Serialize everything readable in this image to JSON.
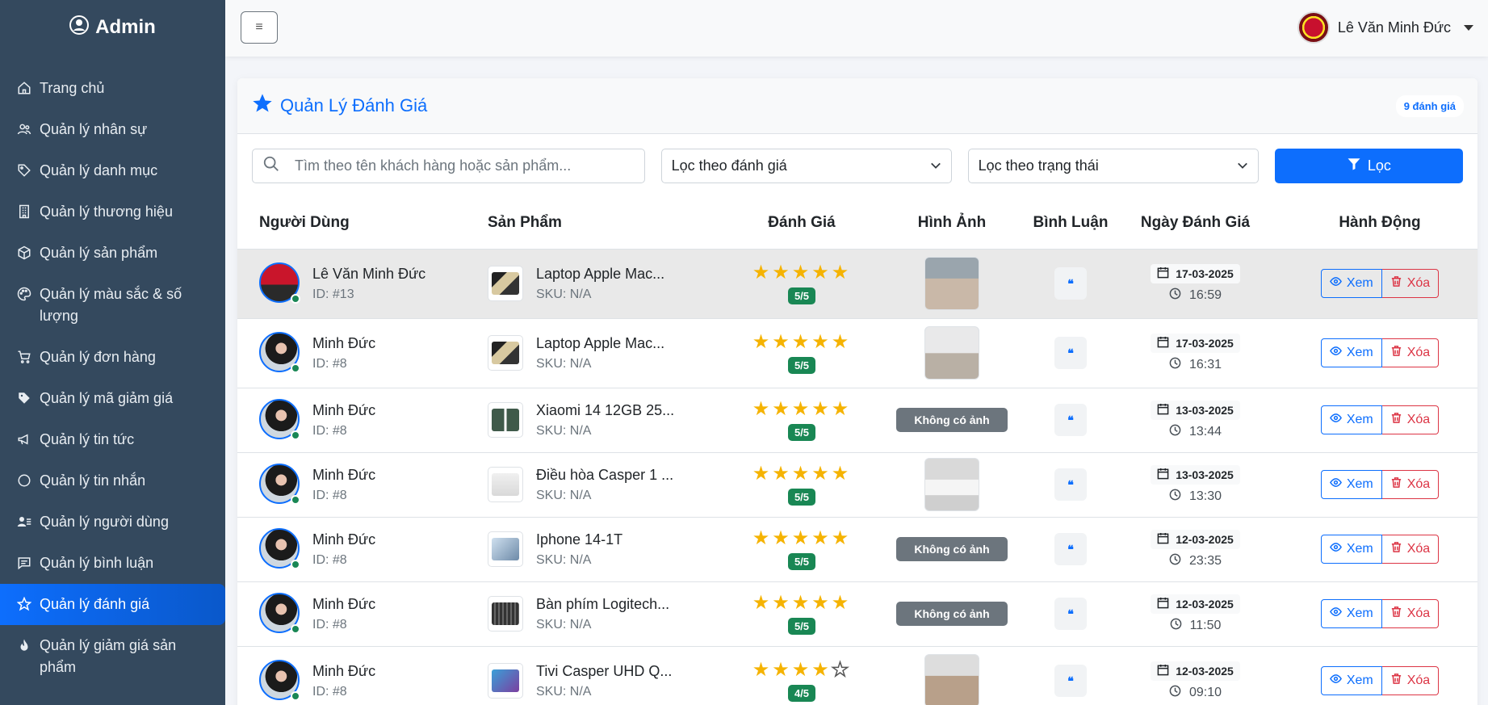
{
  "app": {
    "brand": "Admin"
  },
  "sidebar": {
    "items": [
      {
        "label": "Trang chủ",
        "icon": "home-icon"
      },
      {
        "label": "Quản lý nhân sự",
        "icon": "users-icon"
      },
      {
        "label": "Quản lý danh mục",
        "icon": "tag-icon"
      },
      {
        "label": "Quản lý thương hiệu",
        "icon": "building-icon"
      },
      {
        "label": "Quản lý sản phẩm",
        "icon": "box-icon"
      },
      {
        "label": "Quản lý màu sắc & số lượng",
        "icon": "palette-icon"
      },
      {
        "label": "Quản lý đơn hàng",
        "icon": "cart-icon"
      },
      {
        "label": "Quản lý mã giảm giá",
        "icon": "tag-filled-icon"
      },
      {
        "label": "Quản lý tin tức",
        "icon": "megaphone-icon"
      },
      {
        "label": "Quản lý tin nhắn",
        "icon": "chat-icon"
      },
      {
        "label": "Quản lý người dùng",
        "icon": "user-list-icon"
      },
      {
        "label": "Quản lý bình luận",
        "icon": "comment-icon"
      },
      {
        "label": "Quản lý đánh giá",
        "icon": "star-icon"
      },
      {
        "label": "Quản lý giảm giá sản phẩm",
        "icon": "fire-icon"
      }
    ]
  },
  "topbar": {
    "user_name": "Lê Văn Minh Đức"
  },
  "page": {
    "title": "Quản Lý Đánh Giá",
    "count_badge": "9 đánh giá"
  },
  "filters": {
    "search_placeholder": "Tìm theo tên khách hàng hoặc sản phẩm...",
    "rating_select": "Lọc theo đánh giá",
    "status_select": "Lọc theo trạng thái",
    "filter_button": "Lọc"
  },
  "table": {
    "headers": [
      "Người Dùng",
      "Sản Phẩm",
      "Đánh Giá",
      "Hình Ảnh",
      "Bình Luận",
      "Ngày Đánh Giá",
      "Hành Động"
    ],
    "view_label": "Xem",
    "delete_label": "Xóa",
    "no_image_label": "Không có ảnh",
    "rows": [
      {
        "user": "Lê Văn Minh Đức",
        "user_id": "ID: #13",
        "product": "Laptop Apple Mac...",
        "sku": "SKU: N/A",
        "rating": 5,
        "score": "5/5",
        "has_image": true,
        "date": "17-03-2025",
        "time": "16:59"
      },
      {
        "user": "Minh Đức",
        "user_id": "ID: #8",
        "product": "Laptop Apple Mac...",
        "sku": "SKU: N/A",
        "rating": 5,
        "score": "5/5",
        "has_image": true,
        "date": "17-03-2025",
        "time": "16:31"
      },
      {
        "user": "Minh Đức",
        "user_id": "ID: #8",
        "product": "Xiaomi 14 12GB 25...",
        "sku": "SKU: N/A",
        "rating": 5,
        "score": "5/5",
        "has_image": false,
        "date": "13-03-2025",
        "time": "13:44"
      },
      {
        "user": "Minh Đức",
        "user_id": "ID: #8",
        "product": "Điều hòa Casper 1 ...",
        "sku": "SKU: N/A",
        "rating": 5,
        "score": "5/5",
        "has_image": true,
        "date": "13-03-2025",
        "time": "13:30"
      },
      {
        "user": "Minh Đức",
        "user_id": "ID: #8",
        "product": "Iphone 14-1T",
        "sku": "SKU: N/A",
        "rating": 5,
        "score": "5/5",
        "has_image": false,
        "date": "12-03-2025",
        "time": "23:35"
      },
      {
        "user": "Minh Đức",
        "user_id": "ID: #8",
        "product": "Bàn phím Logitech...",
        "sku": "SKU: N/A",
        "rating": 5,
        "score": "5/5",
        "has_image": false,
        "date": "12-03-2025",
        "time": "11:50"
      },
      {
        "user": "Minh Đức",
        "user_id": "ID: #8",
        "product": "Tivi Casper UHD Q...",
        "sku": "SKU: N/A",
        "rating": 4,
        "score": "4/5",
        "has_image": true,
        "date": "12-03-2025",
        "time": "09:10"
      }
    ]
  },
  "colors": {
    "sidebar_bg": "#34495e",
    "primary": "#0d6efd",
    "success": "#198754",
    "danger": "#dc3545",
    "star": "#f5b301"
  }
}
